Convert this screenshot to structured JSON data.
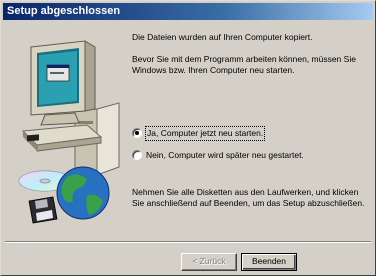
{
  "window": {
    "title": "Setup abgeschlossen"
  },
  "content": {
    "line1": "Die Dateien wurden auf Ihren Computer kopiert.",
    "line2": "Bevor Sie mit dem Programm arbeiten können, müssen Sie Windows bzw. Ihren Computer neu starten.",
    "options": [
      {
        "label": "Ja, Computer jetzt neu starten.",
        "selected": true
      },
      {
        "label": "Nein, Computer wird später neu gestartet.",
        "selected": false
      }
    ],
    "instructions": "Nehmen Sie alle Disketten aus den Laufwerken, und klicken Sie anschließend auf Beenden, um das Setup abzuschließen."
  },
  "buttons": {
    "back": "< Zurück",
    "finish": "Beenden"
  },
  "illustration": {
    "icons": [
      "computer-icon",
      "globe-icon",
      "cd-rom-icon",
      "floppy-disk-icon"
    ]
  },
  "colors": {
    "title_start": "#0a246a",
    "title_end": "#a6caf0",
    "face": "#d4d0c8"
  }
}
